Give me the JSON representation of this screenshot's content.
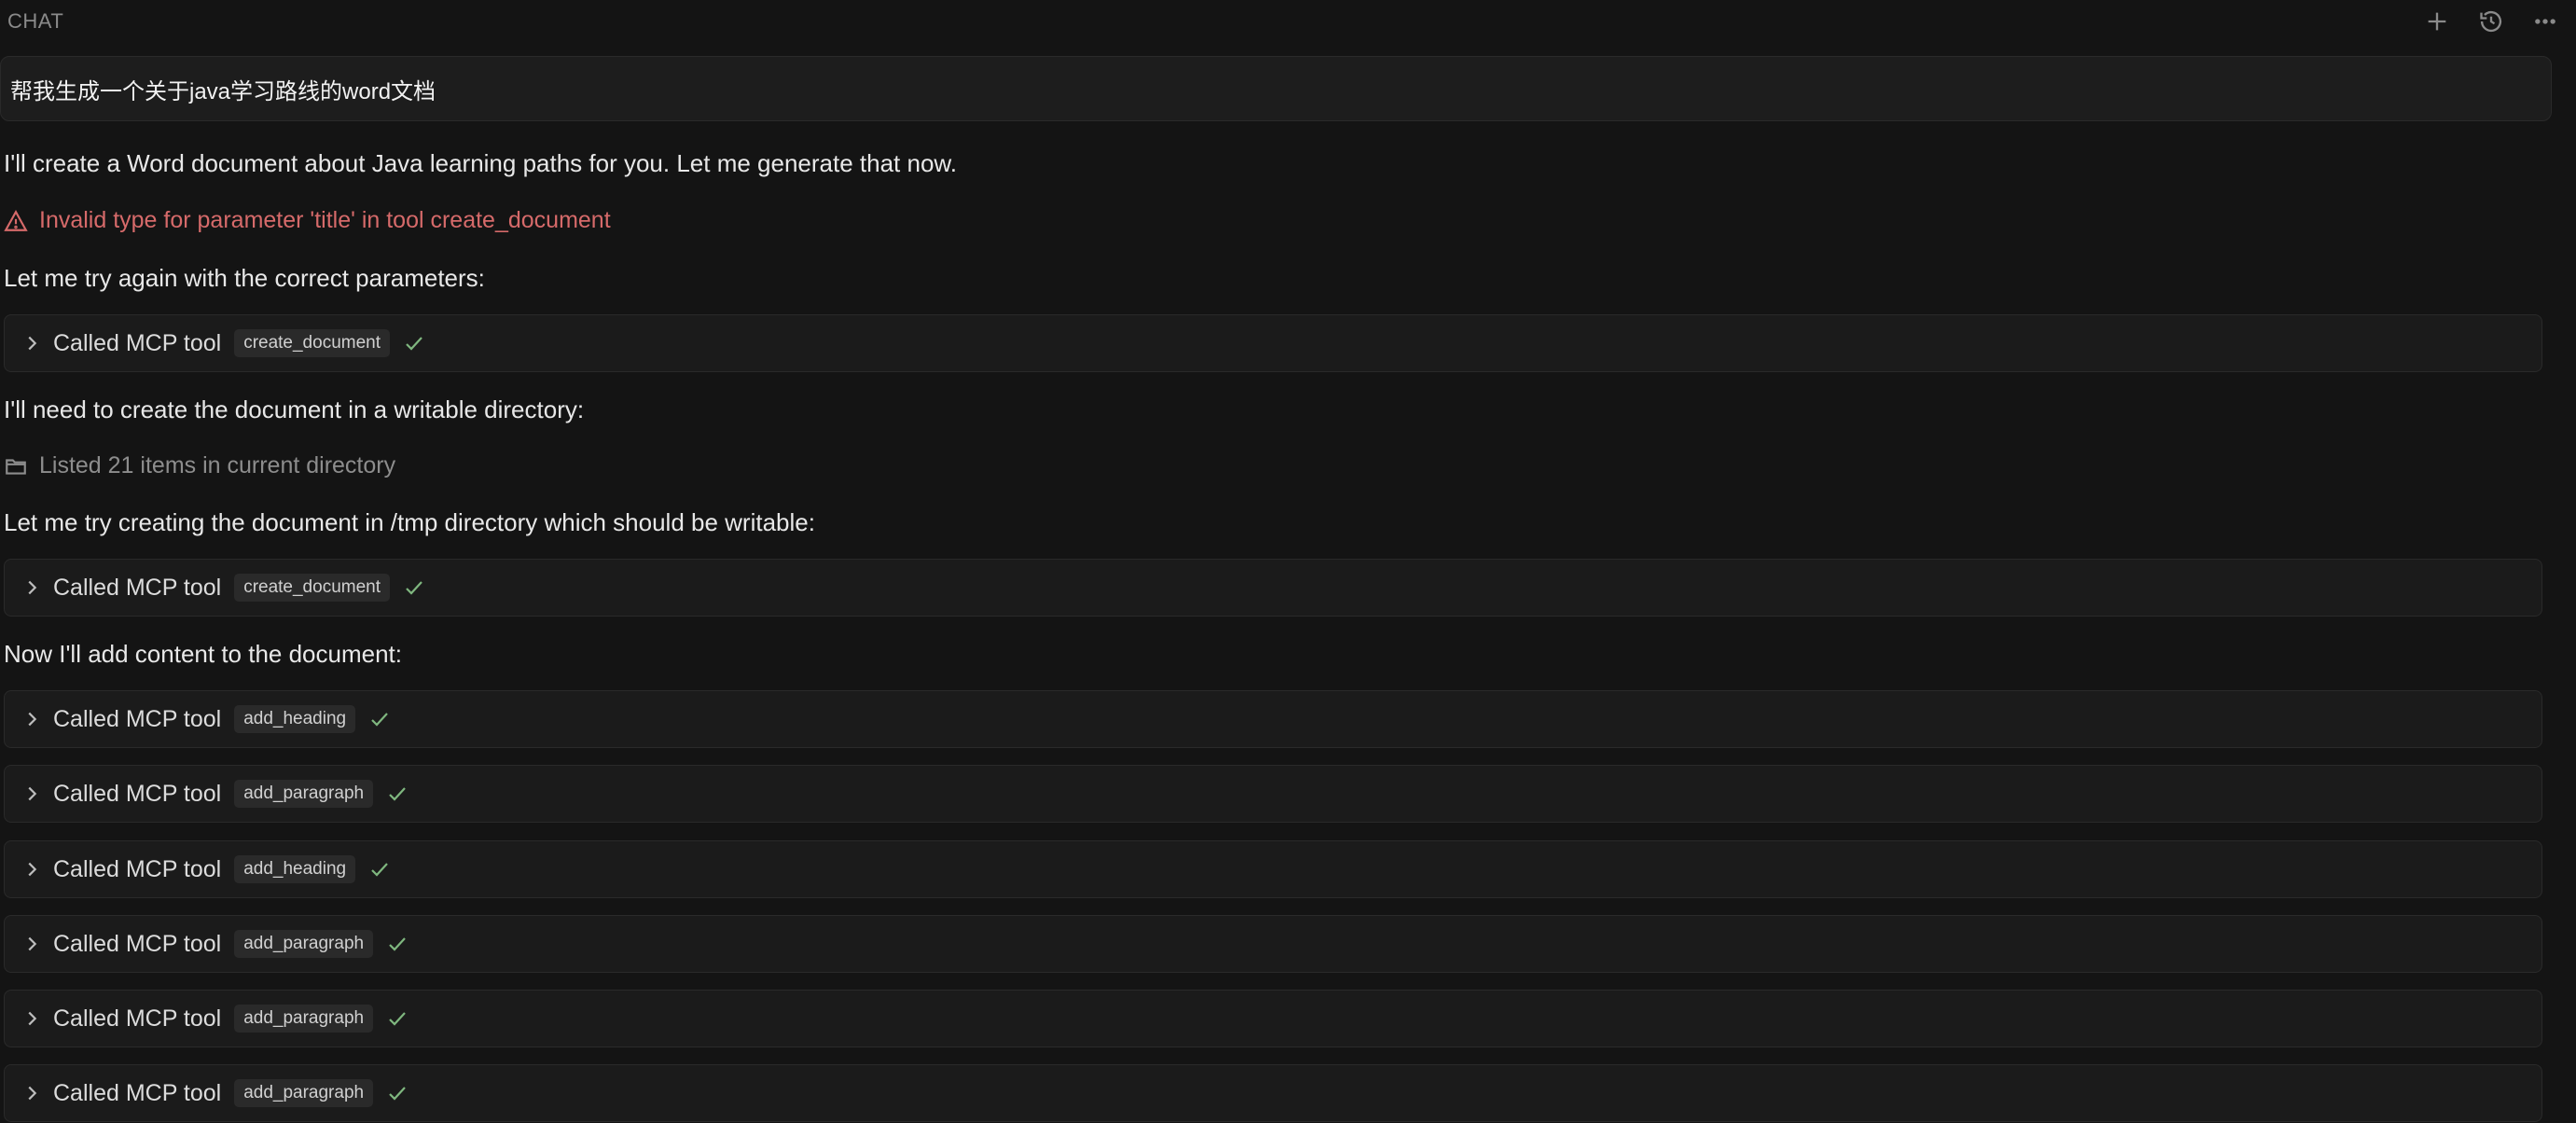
{
  "header": {
    "title": "CHAT",
    "icons": [
      "plus-icon",
      "history-icon",
      "more-icon"
    ]
  },
  "user_message": "帮我生成一个关于java学习路线的word文档",
  "messages": {
    "intro": "I'll create a Word document about Java learning paths for you. Let me generate that now.",
    "error": "Invalid type for parameter 'title' in tool create_document",
    "retry": "Let me try again with the correct parameters:",
    "writable": "I'll need to create the document in a writable directory:",
    "listed": "Listed 21 items in current directory",
    "tmp": "Let me try creating the document in /tmp directory which should be writable:",
    "add_content": "Now I'll add content to the document:"
  },
  "tool_calls": [
    {
      "label": "Called MCP tool",
      "tool": "create_document"
    },
    {
      "label": "Called MCP tool",
      "tool": "create_document"
    },
    {
      "label": "Called MCP tool",
      "tool": "add_heading"
    },
    {
      "label": "Called MCP tool",
      "tool": "add_paragraph"
    },
    {
      "label": "Called MCP tool",
      "tool": "add_heading"
    },
    {
      "label": "Called MCP tool",
      "tool": "add_paragraph"
    },
    {
      "label": "Called MCP tool",
      "tool": "add_paragraph"
    },
    {
      "label": "Called MCP tool",
      "tool": "add_paragraph"
    }
  ],
  "colors": {
    "background": "#141414",
    "error": "#d66a6a",
    "success_check": "#7fb77f",
    "muted": "#8d8d8d"
  }
}
